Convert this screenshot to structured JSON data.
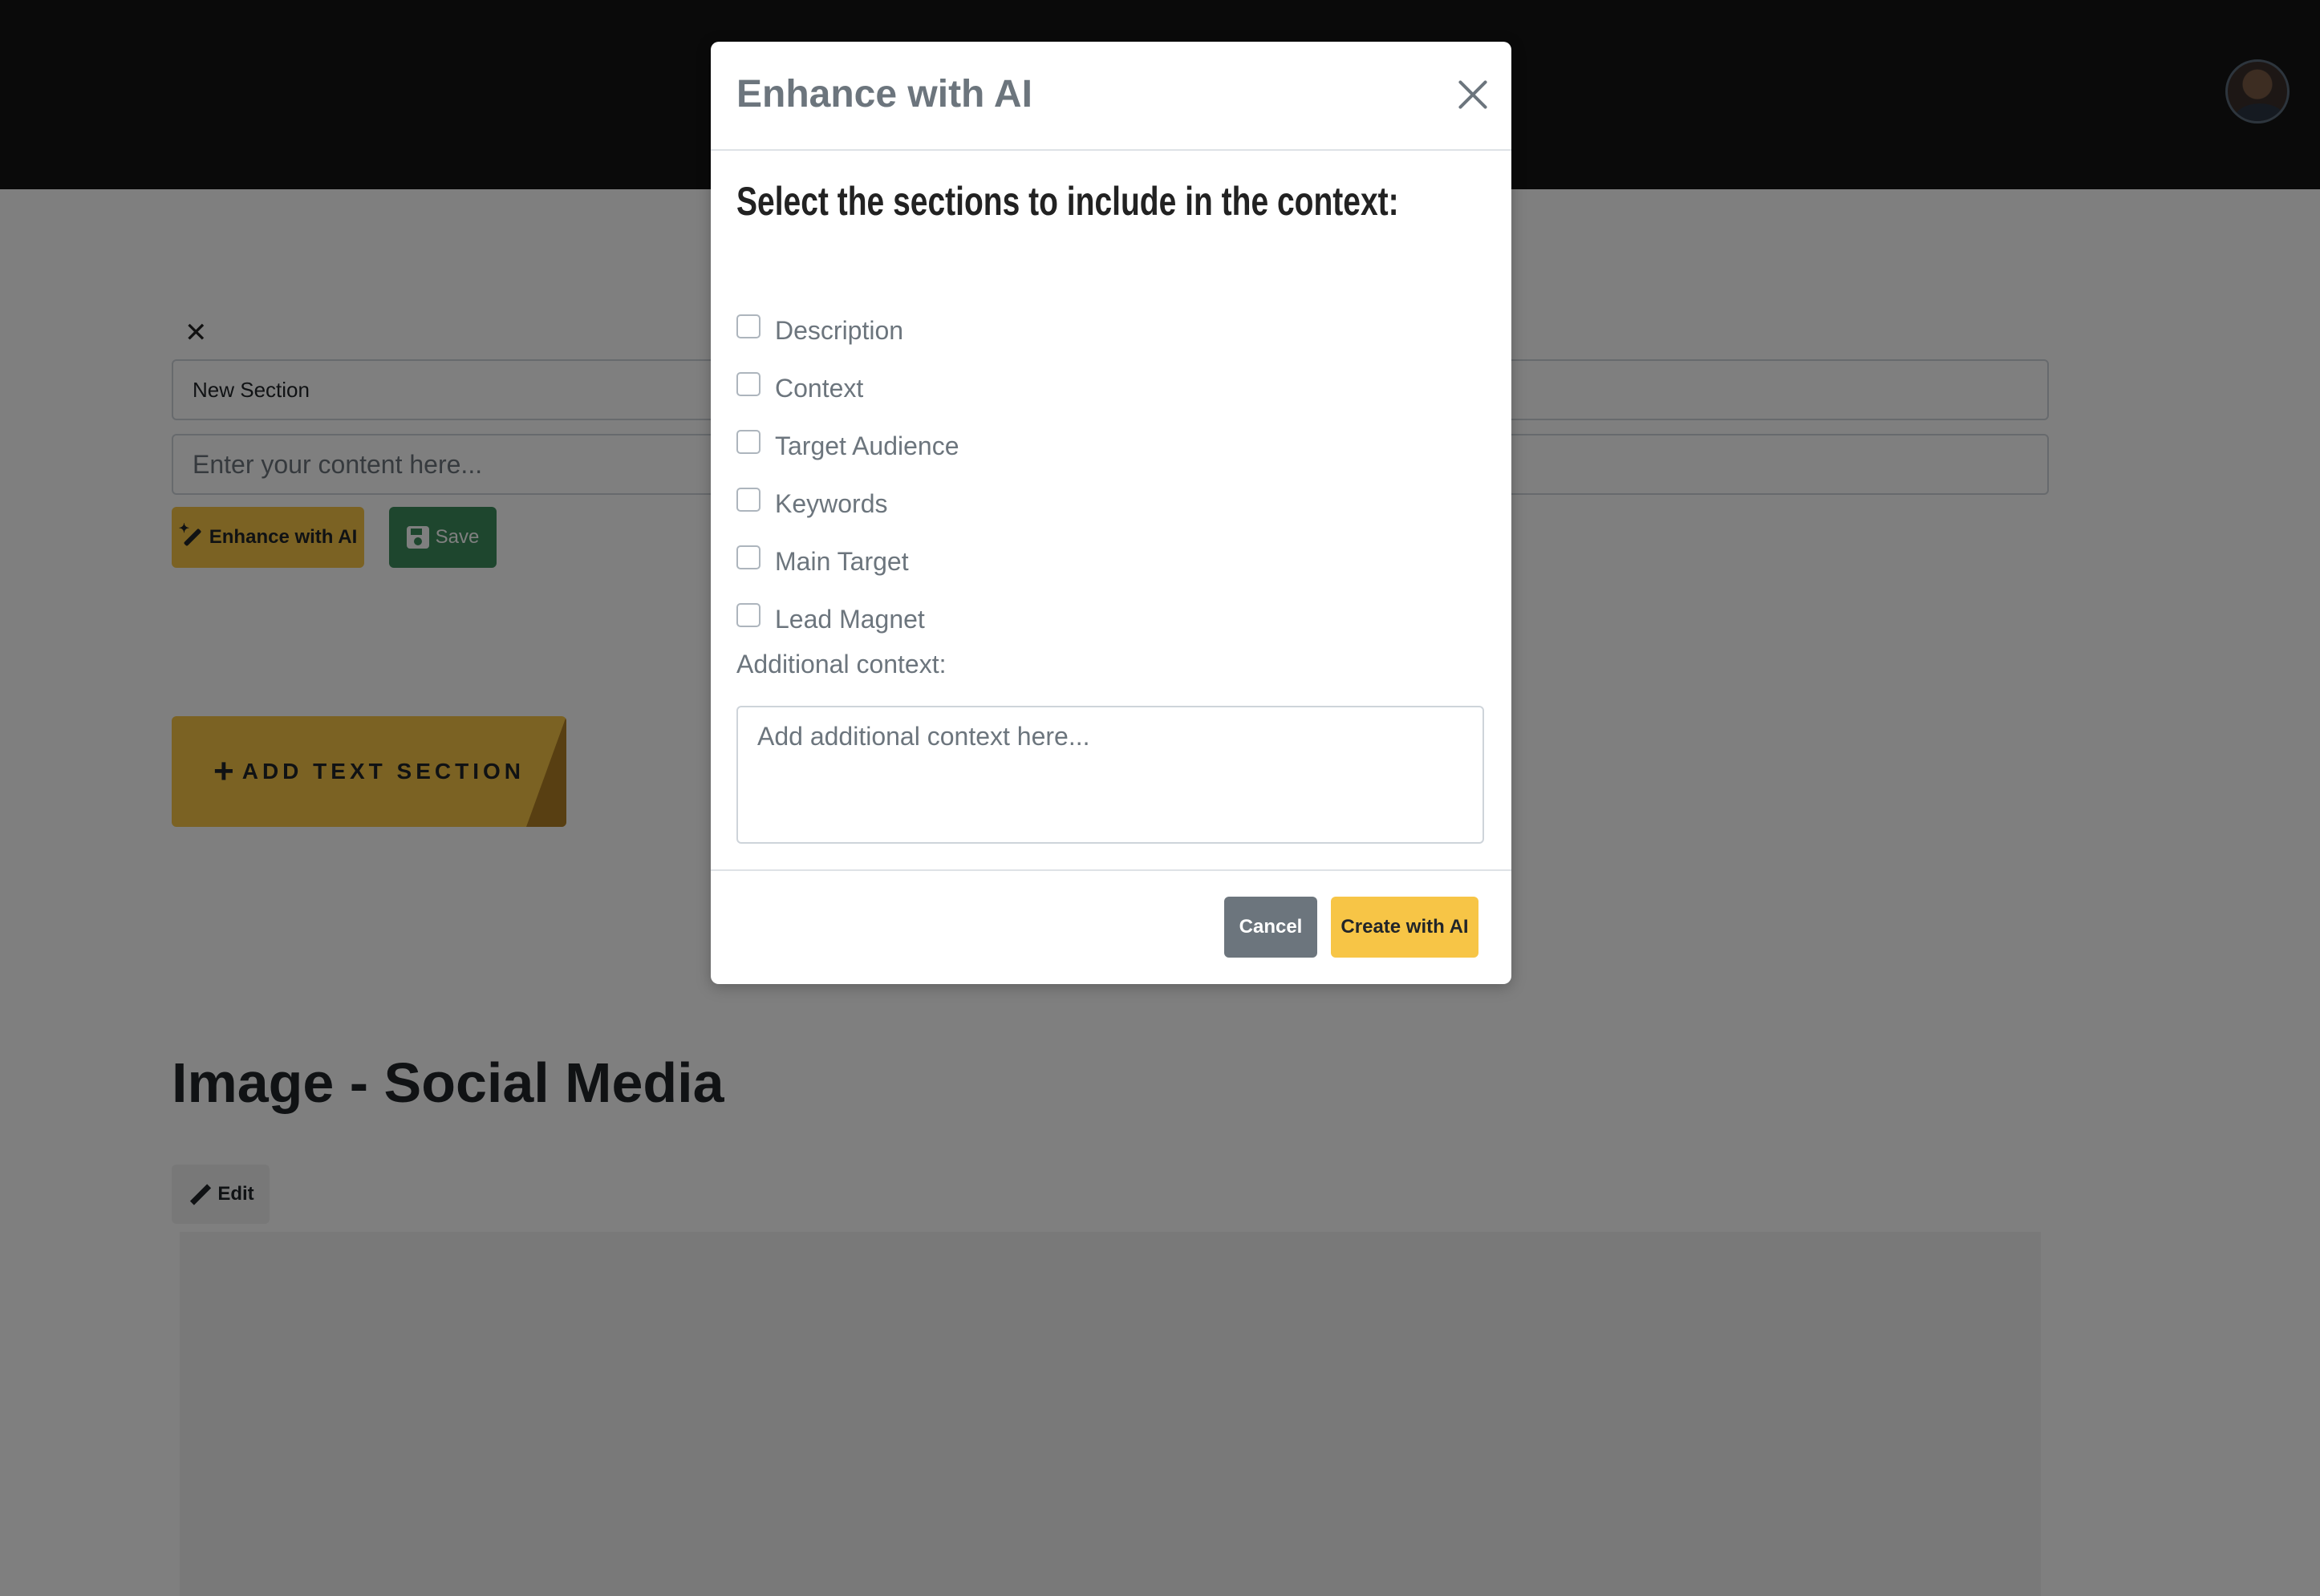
{
  "modal": {
    "title": "Enhance with AI",
    "subtitle": "Select the sections to include in the context:",
    "options": [
      {
        "label": "Description",
        "checked": false
      },
      {
        "label": "Context",
        "checked": false
      },
      {
        "label": "Target Audience",
        "checked": false
      },
      {
        "label": "Keywords",
        "checked": false
      },
      {
        "label": "Main Target",
        "checked": false
      },
      {
        "label": "Lead Magnet",
        "checked": false
      }
    ],
    "additional_label": "Additional context:",
    "additional_placeholder": "Add additional context here...",
    "cancel_label": "Cancel",
    "create_label": "Create with AI"
  },
  "editor": {
    "section_title_value": "New Section",
    "content_placeholder": "Enter your content here...",
    "enhance_label": "Enhance with AI",
    "save_label": "Save",
    "add_section_label": "ADD TEXT SECTION"
  },
  "image_section": {
    "heading": "Image - Social Media",
    "edit_label": "Edit"
  },
  "colors": {
    "accent": "#f7c546",
    "success": "#3c8c5c",
    "secondary": "#6c757d"
  }
}
